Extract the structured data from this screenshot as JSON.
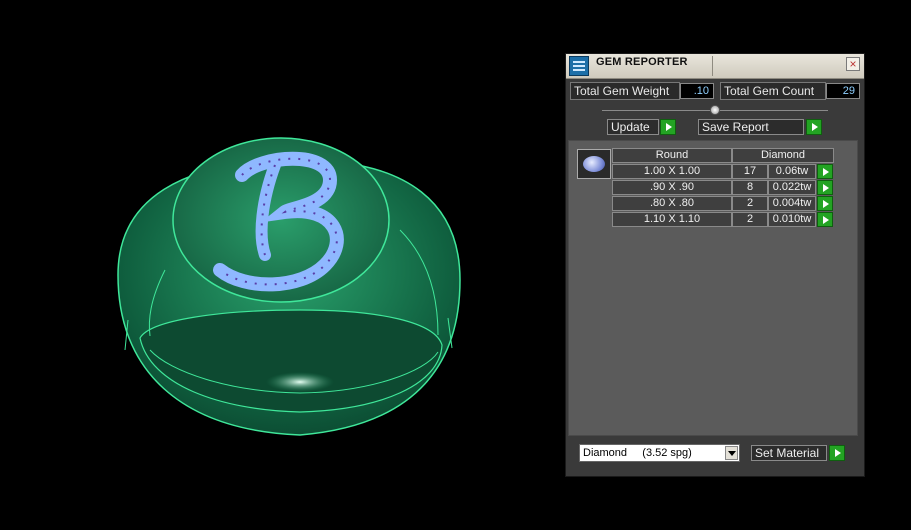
{
  "panel": {
    "title": "GEM REPORTER",
    "total_gem_weight_label": "Total Gem Weight",
    "total_gem_weight_value": ".10",
    "total_gem_count_label": "Total Gem Count",
    "total_gem_count_value": "29",
    "update_label": "Update",
    "save_report_label": "Save Report",
    "set_material_label": "Set Material",
    "material_value": "Diamond     (3.52 spg)",
    "table": {
      "header_shape": "Round",
      "header_material": "Diamond",
      "rows": [
        {
          "size": "1.00 X 1.00",
          "count": "17",
          "weight": "0.06tw"
        },
        {
          "size": ".90 X .90",
          "count": "8",
          "weight": "0.022tw"
        },
        {
          "size": ".80 X .80",
          "count": "2",
          "weight": "0.004tw"
        },
        {
          "size": "1.10 X 1.10",
          "count": "2",
          "weight": "0.010tw"
        }
      ]
    }
  },
  "icons": {
    "app": "gem-reporter-icon",
    "close": "close-icon",
    "arrow": "green-arrow-icon",
    "gem": "round-gem-icon",
    "dropdown": "dropdown-arrow-icon"
  },
  "colors": {
    "ring": "#1f8a5c",
    "ring_edge": "#3fe79a",
    "stones": "#8fb8ff",
    "accent_green": "#23a323",
    "value_text": "#8fd0ff"
  }
}
